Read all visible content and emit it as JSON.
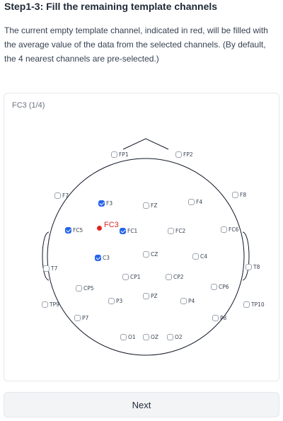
{
  "page": {
    "title": "Step1-3: Fill the remaining template channels",
    "description": "The current empty template channel, indicated in red, will be filled with the average value of the data from the selected channels. (By default, the 4 nearest channels are pre-selected.)"
  },
  "card": {
    "label": "FC3 (1/4)"
  },
  "target_channel": {
    "name": "FC3",
    "color": "#dc2626"
  },
  "channels": [
    {
      "name": "FP1",
      "checked": false
    },
    {
      "name": "FP2",
      "checked": false
    },
    {
      "name": "F7",
      "checked": false
    },
    {
      "name": "F8",
      "checked": false
    },
    {
      "name": "F3",
      "checked": true
    },
    {
      "name": "FZ",
      "checked": false
    },
    {
      "name": "F4",
      "checked": false
    },
    {
      "name": "FC5",
      "checked": true
    },
    {
      "name": "FC1",
      "checked": true
    },
    {
      "name": "FC2",
      "checked": false
    },
    {
      "name": "FC6",
      "checked": false
    },
    {
      "name": "C3",
      "checked": true
    },
    {
      "name": "CZ",
      "checked": false
    },
    {
      "name": "C4",
      "checked": false
    },
    {
      "name": "T7",
      "checked": false
    },
    {
      "name": "T8",
      "checked": false
    },
    {
      "name": "CP1",
      "checked": false
    },
    {
      "name": "CP2",
      "checked": false
    },
    {
      "name": "CP5",
      "checked": false
    },
    {
      "name": "CP6",
      "checked": false
    },
    {
      "name": "PZ",
      "checked": false
    },
    {
      "name": "P3",
      "checked": false
    },
    {
      "name": "P4",
      "checked": false
    },
    {
      "name": "TP9",
      "checked": false
    },
    {
      "name": "TP10",
      "checked": false
    },
    {
      "name": "P7",
      "checked": false
    },
    {
      "name": "P8",
      "checked": false
    },
    {
      "name": "O1",
      "checked": false
    },
    {
      "name": "OZ",
      "checked": false
    },
    {
      "name": "O2",
      "checked": false
    }
  ],
  "next_button": {
    "label": "Next"
  },
  "colors": {
    "accent": "#2563eb",
    "target": "#dc2626"
  }
}
